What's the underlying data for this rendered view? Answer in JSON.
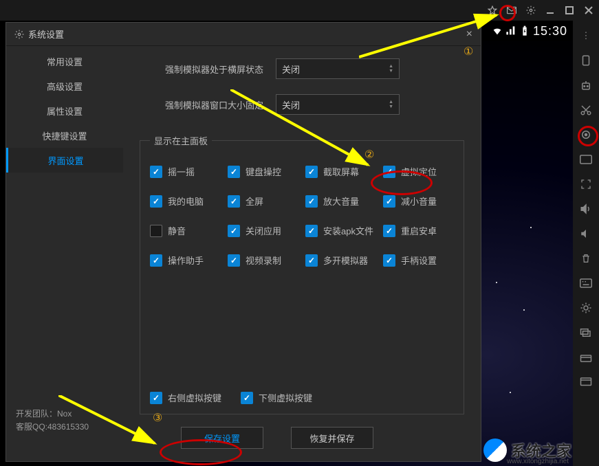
{
  "titlebar": {
    "icons": [
      "pin",
      "mail",
      "gear",
      "minimize",
      "maximize",
      "close"
    ]
  },
  "statusbar": {
    "time": "15:30"
  },
  "sideToolbar": {
    "icons": [
      "more",
      "rotate",
      "robot",
      "scissors",
      "location",
      "keyboard",
      "fullscreen",
      "vol-up",
      "vol-down",
      "trash",
      "keymap",
      "brightness",
      "recent",
      "install",
      "apk"
    ]
  },
  "dialog": {
    "title": "系统设置",
    "close": "×",
    "sidebar": {
      "items": [
        {
          "label": "常用设置"
        },
        {
          "label": "高级设置"
        },
        {
          "label": "属性设置"
        },
        {
          "label": "快捷键设置"
        },
        {
          "label": "界面设置"
        }
      ],
      "footer": {
        "team": "开发团队：Nox",
        "qq": "客服QQ:483615330"
      }
    },
    "form": {
      "row1": {
        "label": "强制模拟器处于横屏状态",
        "value": "关闭"
      },
      "row2": {
        "label": "强制模拟器窗口大小固定",
        "value": "关闭"
      }
    },
    "fieldset": {
      "legend": "显示在主面板",
      "checks": [
        {
          "label": "摇一摇",
          "checked": true
        },
        {
          "label": "键盘操控",
          "checked": true
        },
        {
          "label": "截取屏幕",
          "checked": true
        },
        {
          "label": "虚拟定位",
          "checked": true
        },
        {
          "label": "我的电脑",
          "checked": true
        },
        {
          "label": "全屏",
          "checked": true
        },
        {
          "label": "放大音量",
          "checked": true
        },
        {
          "label": "减小音量",
          "checked": true
        },
        {
          "label": "静音",
          "checked": false
        },
        {
          "label": "关闭应用",
          "checked": true
        },
        {
          "label": "安装apk文件",
          "checked": true
        },
        {
          "label": "重启安卓",
          "checked": true
        },
        {
          "label": "操作助手",
          "checked": true
        },
        {
          "label": "视频录制",
          "checked": true
        },
        {
          "label": "多开模拟器",
          "checked": true
        },
        {
          "label": "手柄设置",
          "checked": true
        }
      ],
      "bottom": [
        {
          "label": "右侧虚拟按键",
          "checked": true
        },
        {
          "label": "下侧虚拟按键",
          "checked": true
        }
      ]
    },
    "buttons": {
      "save": "保存设置",
      "restore": "恢复并保存"
    }
  },
  "annotations": {
    "num1": "①",
    "num2": "②",
    "num3": "③"
  },
  "watermark": {
    "text": "系统之家",
    "url": "www.xitongzhijia.net"
  }
}
